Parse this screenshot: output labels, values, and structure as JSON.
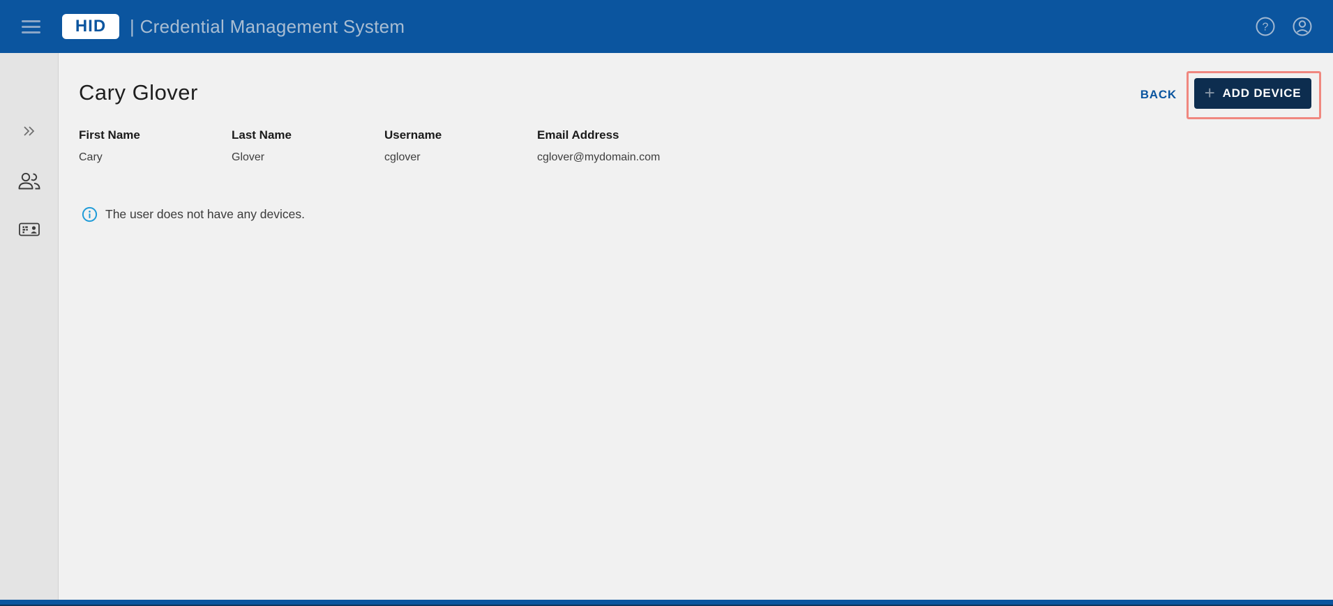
{
  "header": {
    "logo_text": "HID",
    "app_title": "| Credential Management System"
  },
  "icons": {
    "menu": "hamburger-icon",
    "help": "question-circle-icon",
    "account": "user-circle-icon",
    "sidebar_expand": "double-chevron-right-icon",
    "sidebar_users": "people-icon",
    "sidebar_credentials": "id-badge-icon",
    "info": "info-circle-icon",
    "plus": "plus-icon"
  },
  "main": {
    "page_title": "Cary Glover",
    "back_label": "BACK",
    "add_device_label": "ADD DEVICE",
    "plus_glyph": "+",
    "fields": [
      {
        "label": "First Name",
        "value": "Cary"
      },
      {
        "label": "Last Name",
        "value": "Glover"
      },
      {
        "label": "Username",
        "value": "cglover"
      },
      {
        "label": "Email Address",
        "value": "cglover@mydomain.com"
      }
    ],
    "info_message": "The user does not have any devices."
  },
  "colors": {
    "header_blue": "#0b559f",
    "header_text": "#a9bdd2",
    "button_navy": "#0d2d4f",
    "highlight_red": "#f0877f",
    "back_blue": "#0b559f",
    "info_blue": "#1f9bd8",
    "sidebar_gray": "#e4e4e4",
    "main_bg": "#f1f1f1"
  }
}
